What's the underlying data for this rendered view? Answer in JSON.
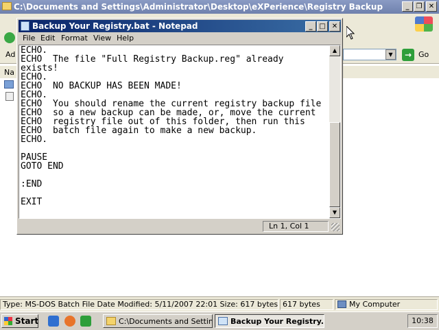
{
  "explorer": {
    "title": "C:\\Documents and Settings\\Administrator\\Desktop\\eXPerience\\Registry Backup",
    "address_prefix": "Ad",
    "go_label": "Go",
    "header_prefix": "Na",
    "status": {
      "type_text": "Type: MS-DOS Batch File Date Modified: 5/11/2007 22:01 Size: 617 bytes",
      "size": "617 bytes",
      "location": "My Computer"
    }
  },
  "notepad": {
    "title": "Backup Your Registry.bat - Notepad",
    "menu": [
      "File",
      "Edit",
      "Format",
      "View",
      "Help"
    ],
    "content": "ECHO.\nECHO  The file \"Full Registry Backup.reg\" already\nexists!\nECHO.\nECHO  NO BACKUP HAS BEEN MADE!\nECHO.\nECHO  You should rename the current registry backup file\nECHO  so a new backup can be made, or, move the current\nECHO  registry file out of this folder, then run this\nECHO  batch file again to make a new backup.\nECHO.\n\nPAUSE\nGOTO END\n\n:END\n\nEXIT",
    "status": "Ln 1, Col 1"
  },
  "taskbar": {
    "start_label": "Start",
    "tasks": [
      "C:\\Documents and Settin...",
      "Backup Your Registry..."
    ],
    "clock": "10:38"
  },
  "colors": {
    "active_title": "#0a246a",
    "inactive_title": "#7a8bb5",
    "go_green": "#2e9e3a"
  }
}
